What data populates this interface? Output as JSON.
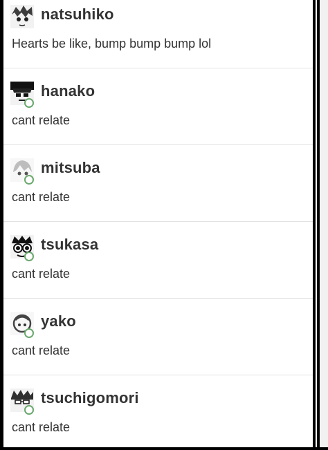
{
  "messages": [
    {
      "username": "natsuhiko",
      "text": "Hearts be like, bump bump bump lol",
      "avatar_icon": "avatar-icon"
    },
    {
      "username": "hanako",
      "text": "cant relate",
      "avatar_icon": "avatar-icon"
    },
    {
      "username": "mitsuba",
      "text": "cant relate",
      "avatar_icon": "avatar-icon"
    },
    {
      "username": "tsukasa",
      "text": "cant relate",
      "avatar_icon": "avatar-icon"
    },
    {
      "username": "yako",
      "text": "cant relate",
      "avatar_icon": "avatar-icon"
    },
    {
      "username": "tsuchigomori",
      "text": "cant relate",
      "avatar_icon": "avatar-icon"
    }
  ],
  "colors": {
    "text": "#333333",
    "online": "#6aa96e",
    "divider": "#e2e2e2"
  }
}
